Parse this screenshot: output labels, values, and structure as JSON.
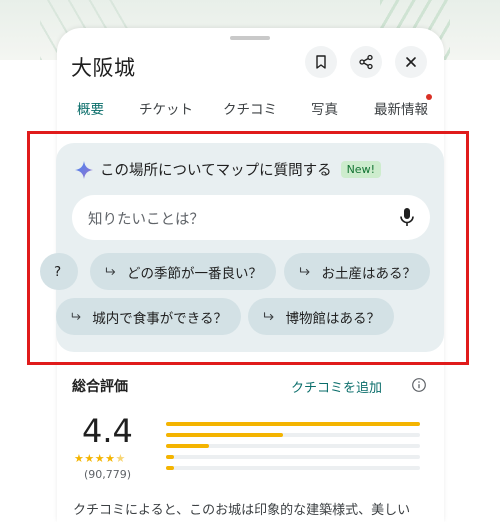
{
  "place": {
    "title": "大阪城"
  },
  "tabs": [
    {
      "label": "概要"
    },
    {
      "label": "チケット"
    },
    {
      "label": "クチコミ"
    },
    {
      "label": "写真"
    },
    {
      "label": "最新情報"
    }
  ],
  "ask": {
    "title": "この場所についてマップに質問する",
    "badge": "New!",
    "placeholder": "知りたいことは？",
    "chips_row1": [
      "?",
      "どの季節が一番良い？",
      "お土産はある？"
    ],
    "chips_row2": [
      "城内で食事ができる？",
      "博物館はある？"
    ]
  },
  "ratings": {
    "title": "総合評価",
    "add_review": "クチコミを追加",
    "score": "4.4",
    "stars": 4.4,
    "count": "(90,779)",
    "distribution": [
      1.0,
      0.46,
      0.17,
      0.03,
      0.03
    ]
  },
  "summary": "クチコミによると、このお城は印象的な建築様式、美しい",
  "colors": {
    "accent": "#0b6e6b",
    "star": "#f4b400",
    "highlight_box": "#e01b1b",
    "card_bg": "#e8eff1",
    "chip_bg": "#d3e1e5"
  }
}
